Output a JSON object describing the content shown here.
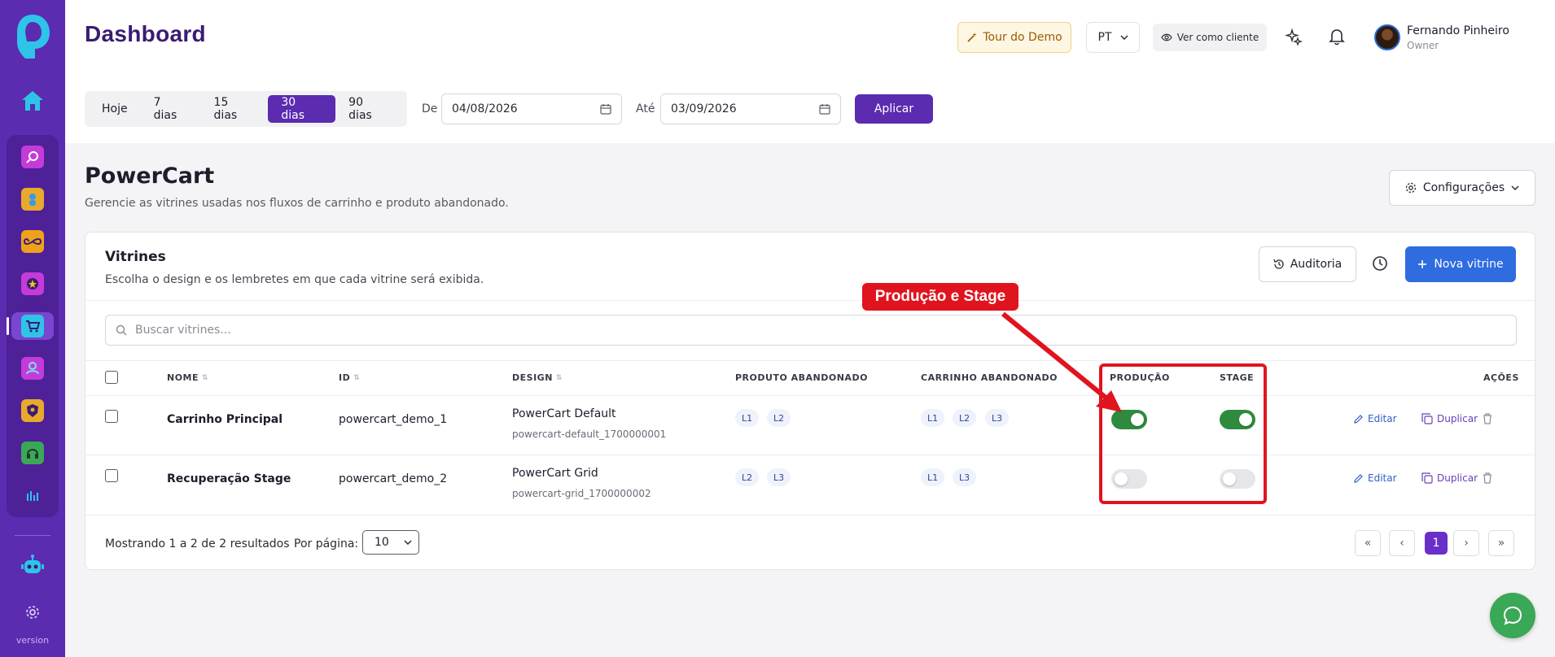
{
  "sidebar": {
    "apps": [
      "search-app",
      "user-app",
      "infinity-app",
      "star-app",
      "cart-app",
      "people-app",
      "shield-app",
      "headset-app",
      "chart-app"
    ],
    "active_index": 4,
    "version": "version"
  },
  "header": {
    "title": "Dashboard",
    "tour_label": "Tour do Demo",
    "lang": "PT",
    "view_client_label": "Ver como cliente",
    "user_name": "Fernando Pinheiro",
    "user_role": "Owner"
  },
  "filters": {
    "ranges": [
      "Hoje",
      "7 dias",
      "15 dias",
      "30 dias",
      "90 dias"
    ],
    "active_range": "30 dias",
    "from_label": "De",
    "from_value": "04/08/2026",
    "to_label": "Até",
    "to_value": "03/09/2026",
    "apply_label": "Aplicar"
  },
  "section": {
    "title": "PowerCart",
    "subtitle": "Gerencie as vitrines usadas nos fluxos de carrinho e produto abandonado.",
    "config_label": "Configurações"
  },
  "card": {
    "title": "Vitrines",
    "subtitle": "Escolha o design e os lembretes em que cada vitrine será exibida.",
    "audit_label": "Auditoria",
    "new_label": "Nova vitrine",
    "search_placeholder": "Buscar vitrines...",
    "columns": {
      "name": "NOME",
      "id": "ID",
      "design": "DESIGN",
      "produto": "PRODUTO ABANDONADO",
      "carrinho": "CARRINHO ABANDONADO",
      "producao": "PRODUÇÃO",
      "stage": "STAGE",
      "acoes": "AÇÕES"
    },
    "rows": [
      {
        "name": "Carrinho Principal",
        "id": "powercart_demo_1",
        "design": "PowerCart Default",
        "design_id": "powercart-default_1700000001",
        "produto": [
          "L1",
          "L2"
        ],
        "carrinho": [
          "L1",
          "L2",
          "L3"
        ],
        "producao": true,
        "stage": true
      },
      {
        "name": "Recuperação Stage",
        "id": "powercart_demo_2",
        "design": "PowerCart Grid",
        "design_id": "powercart-grid_1700000002",
        "produto": [
          "L2",
          "L3"
        ],
        "carrinho": [
          "L1",
          "L3"
        ],
        "producao": false,
        "stage": false
      }
    ],
    "edit_label": "Editar",
    "dup_label": "Duplicar",
    "footer_text": "Mostrando 1 a 2 de 2 resultados",
    "per_page_label": "Por página:",
    "per_page_value": "10",
    "current_page": "1"
  },
  "annotation": {
    "label": "Produção e Stage",
    "color": "#e0141e"
  },
  "colors": {
    "brand": "#5b2bb0",
    "primary_blue": "#2f6ce0",
    "toggle_on": "#2e8b3e"
  }
}
